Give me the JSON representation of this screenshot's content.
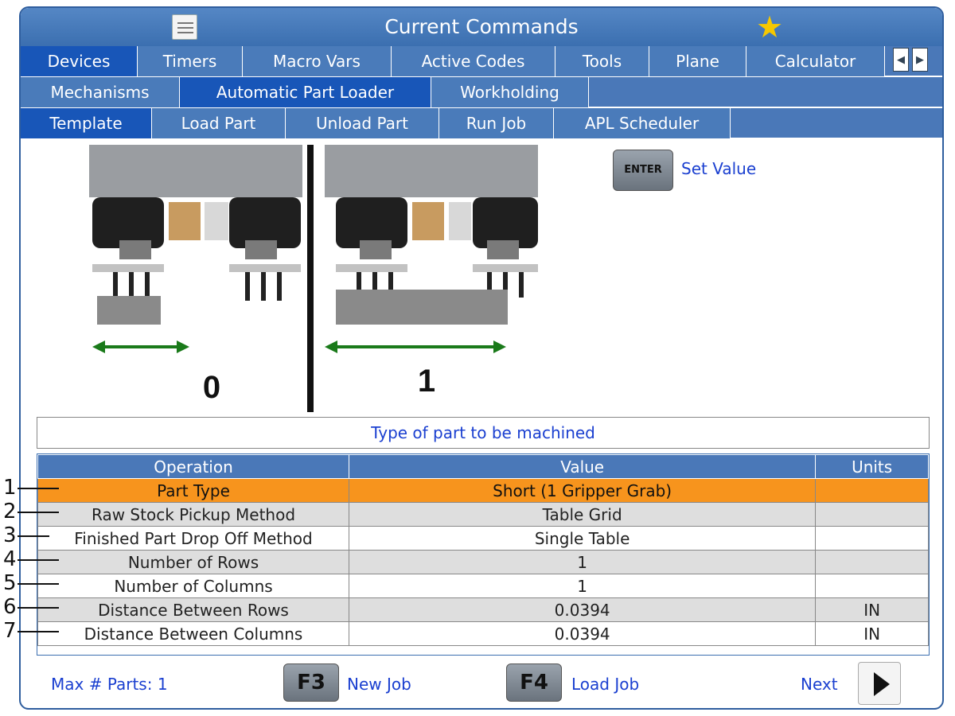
{
  "window": {
    "title": "Current Commands",
    "favorite_icon": "star-icon"
  },
  "tabs_row1": [
    {
      "label": "Devices",
      "active": true
    },
    {
      "label": "Timers",
      "active": false
    },
    {
      "label": "Macro Vars",
      "active": false
    },
    {
      "label": "Active Codes",
      "active": false
    },
    {
      "label": "Tools",
      "active": false
    },
    {
      "label": "Plane",
      "active": false
    },
    {
      "label": "Calculator",
      "active": false
    }
  ],
  "tabs_row2": [
    {
      "label": "Mechanisms",
      "active": false
    },
    {
      "label": "Automatic Part Loader",
      "active": true
    },
    {
      "label": "Workholding",
      "active": false
    }
  ],
  "tabs_row3": [
    {
      "label": "Template",
      "active": true
    },
    {
      "label": "Load Part",
      "active": false
    },
    {
      "label": "Unload Part",
      "active": false
    },
    {
      "label": "Run Job",
      "active": false
    },
    {
      "label": "APL Scheduler",
      "active": false
    }
  ],
  "illustration": {
    "label_left": "0",
    "label_right": "1"
  },
  "enter": {
    "key": "ENTER",
    "label": "Set Value"
  },
  "description": "Type of part to be machined",
  "table": {
    "headers": [
      "Operation",
      "Value",
      "Units"
    ],
    "rows": [
      {
        "num": "1",
        "operation": "Part Type",
        "value": "Short (1 Gripper Grab)",
        "units": ""
      },
      {
        "num": "2",
        "operation": "Raw Stock Pickup Method",
        "value": "Table Grid",
        "units": ""
      },
      {
        "num": "3",
        "operation": "Finished Part Drop Off Method",
        "value": "Single Table",
        "units": ""
      },
      {
        "num": "4",
        "operation": "Number of Rows",
        "value": "1",
        "units": ""
      },
      {
        "num": "5",
        "operation": "Number of Columns",
        "value": "1",
        "units": ""
      },
      {
        "num": "6",
        "operation": "Distance Between Rows",
        "value": "0.0394",
        "units": "IN"
      },
      {
        "num": "7",
        "operation": "Distance Between Columns",
        "value": "0.0394",
        "units": "IN"
      }
    ]
  },
  "footer": {
    "max_parts": "Max # Parts: 1",
    "f3_key": "F3",
    "f3_label": "New Job",
    "f4_key": "F4",
    "f4_label": "Load Job",
    "next_label": "Next"
  },
  "colors": {
    "accent": "#1856b8",
    "tab": "#4a7bba",
    "selected_row": "#f7941d",
    "link_text": "#1a3fd0"
  }
}
